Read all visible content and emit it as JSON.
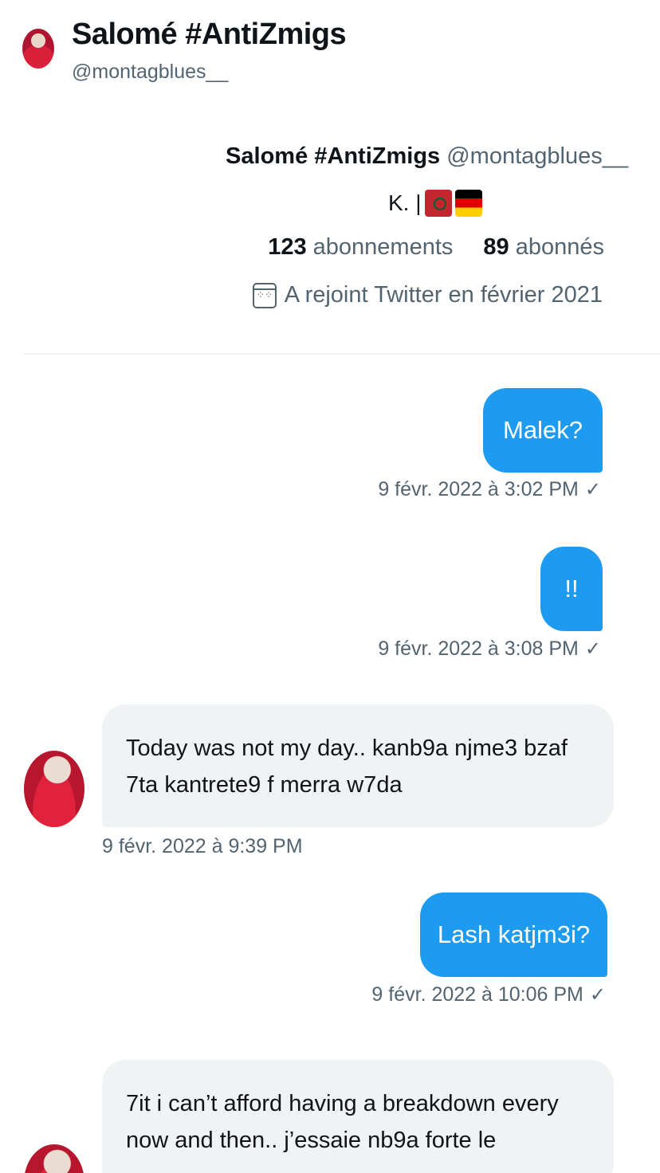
{
  "header": {
    "name": "Salomé #AntiZmigs",
    "handle": "@montagblues__"
  },
  "profile": {
    "name": "Salomé #AntiZmigs",
    "handle": "@montagblues__",
    "bio_text": "K. |",
    "bio_flags": [
      "flag-morocco",
      "flag-germany"
    ],
    "following_count": "123",
    "following_label": "abonnements",
    "followers_count": "89",
    "followers_label": "abonnés",
    "joined": "A rejoint Twitter en février 2021"
  },
  "messages": [
    {
      "direction": "out",
      "text": "Malek?",
      "time": "9 févr. 2022 à 3:02 PM",
      "status": "✓"
    },
    {
      "direction": "out",
      "text": "!!",
      "time": "9 févr. 2022 à 3:08 PM",
      "status": "✓"
    },
    {
      "direction": "in",
      "text_line1": "Today was not my day.. kanb9a njme3 bzaf",
      "text_line2": "7ta kantrete9 f merra w7da",
      "time": "9 févr. 2022 à 9:39 PM"
    },
    {
      "direction": "out",
      "text": "Lash katjm3i?",
      "time": "9 févr. 2022 à 10:06 PM",
      "status": "✓"
    },
    {
      "direction": "in",
      "text_line1": "7it i can’t afford having a breakdown every",
      "text_line2": "now and then.. j’essaie nb9a forte le"
    }
  ],
  "colors": {
    "accent": "#1d9bf0",
    "incoming_bubble": "#eff3f4",
    "secondary_text": "#536471"
  }
}
